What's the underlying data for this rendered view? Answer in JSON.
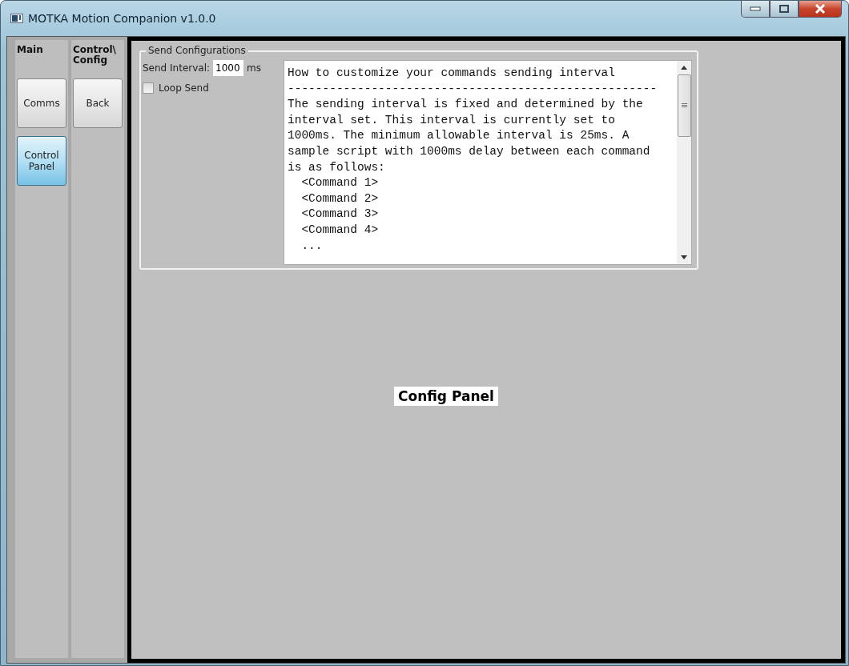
{
  "window": {
    "title": "MOTKA Motion Companion v1.0.0"
  },
  "nav_columns": [
    {
      "header": "Main",
      "buttons": [
        {
          "label": "Comms",
          "selected": false
        },
        {
          "label": "Control\nPanel",
          "selected": true
        }
      ]
    },
    {
      "header": "Control\\\nConfig",
      "buttons": [
        {
          "label": "Back",
          "selected": false
        }
      ]
    }
  ],
  "send_configurations": {
    "title": "Send Configurations",
    "interval_label": "Send Interval:",
    "interval_value": "1000",
    "interval_unit": "ms",
    "loop_send": {
      "label": "Loop Send",
      "checked": false
    },
    "help_lines": [
      "How to customize your commands sending interval",
      "-----------------------------------------------------",
      "The sending interval is fixed and determined by the",
      "interval set. This interval is currently set to",
      "1000ms. The minimum allowable interval is 25ms. A",
      "sample script with 1000ms delay between each command",
      "is as follows:",
      "  <Command 1>",
      "  <Command 2>",
      "  <Command 3>",
      "  <Command 4>",
      "  ..."
    ]
  },
  "panel_label": "Config Panel"
}
